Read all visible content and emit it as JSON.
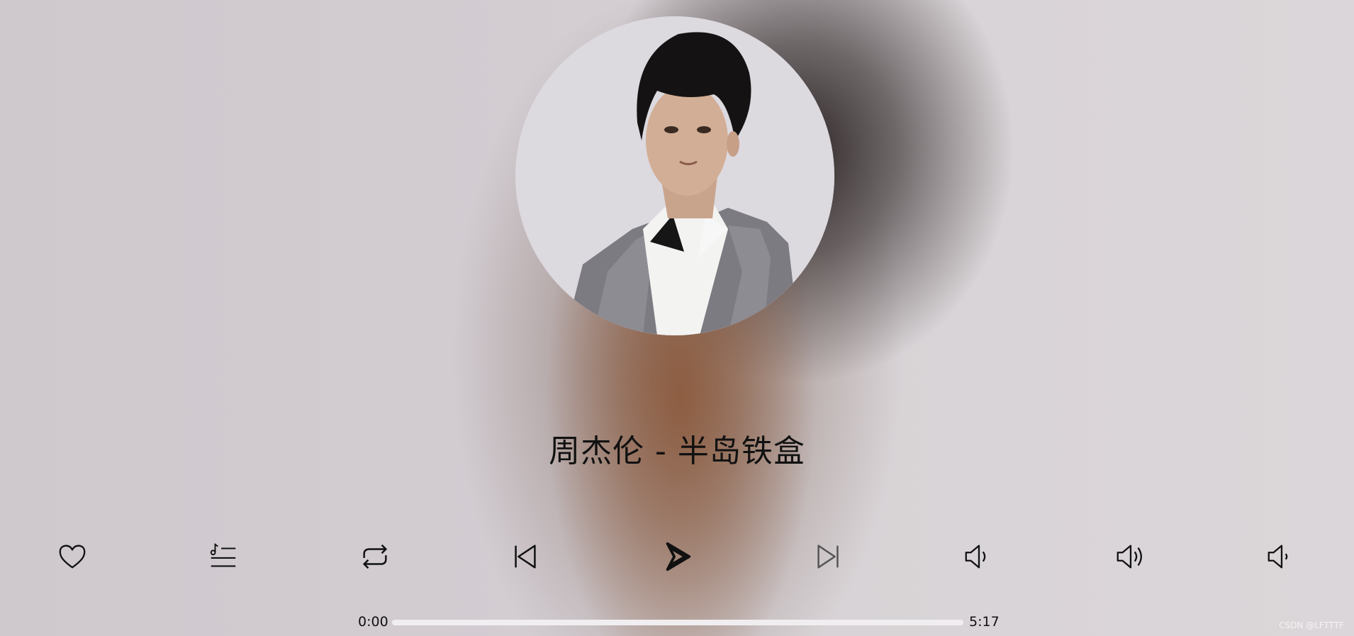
{
  "player": {
    "song_title": "周杰伦 - 半岛铁盒",
    "current_time": "0:00",
    "duration": "5:17",
    "progress": 0.0
  },
  "controls": [
    {
      "name": "favorite-button",
      "icon": "heart-icon"
    },
    {
      "name": "playlist-button",
      "icon": "playlist-icon"
    },
    {
      "name": "repeat-button",
      "icon": "repeat-icon"
    },
    {
      "name": "previous-button",
      "icon": "previous-icon"
    },
    {
      "name": "play-button",
      "icon": "play-icon"
    },
    {
      "name": "next-button",
      "icon": "next-icon"
    },
    {
      "name": "volume-down-button",
      "icon": "volume-medium-icon"
    },
    {
      "name": "volume-up-button",
      "icon": "volume-high-icon"
    },
    {
      "name": "mute-button",
      "icon": "volume-low-icon"
    }
  ],
  "watermark": "CSDN @LFTTTF",
  "colors": {
    "text": "#111111",
    "track": "#f0eef0",
    "next_icon": "#555555"
  }
}
